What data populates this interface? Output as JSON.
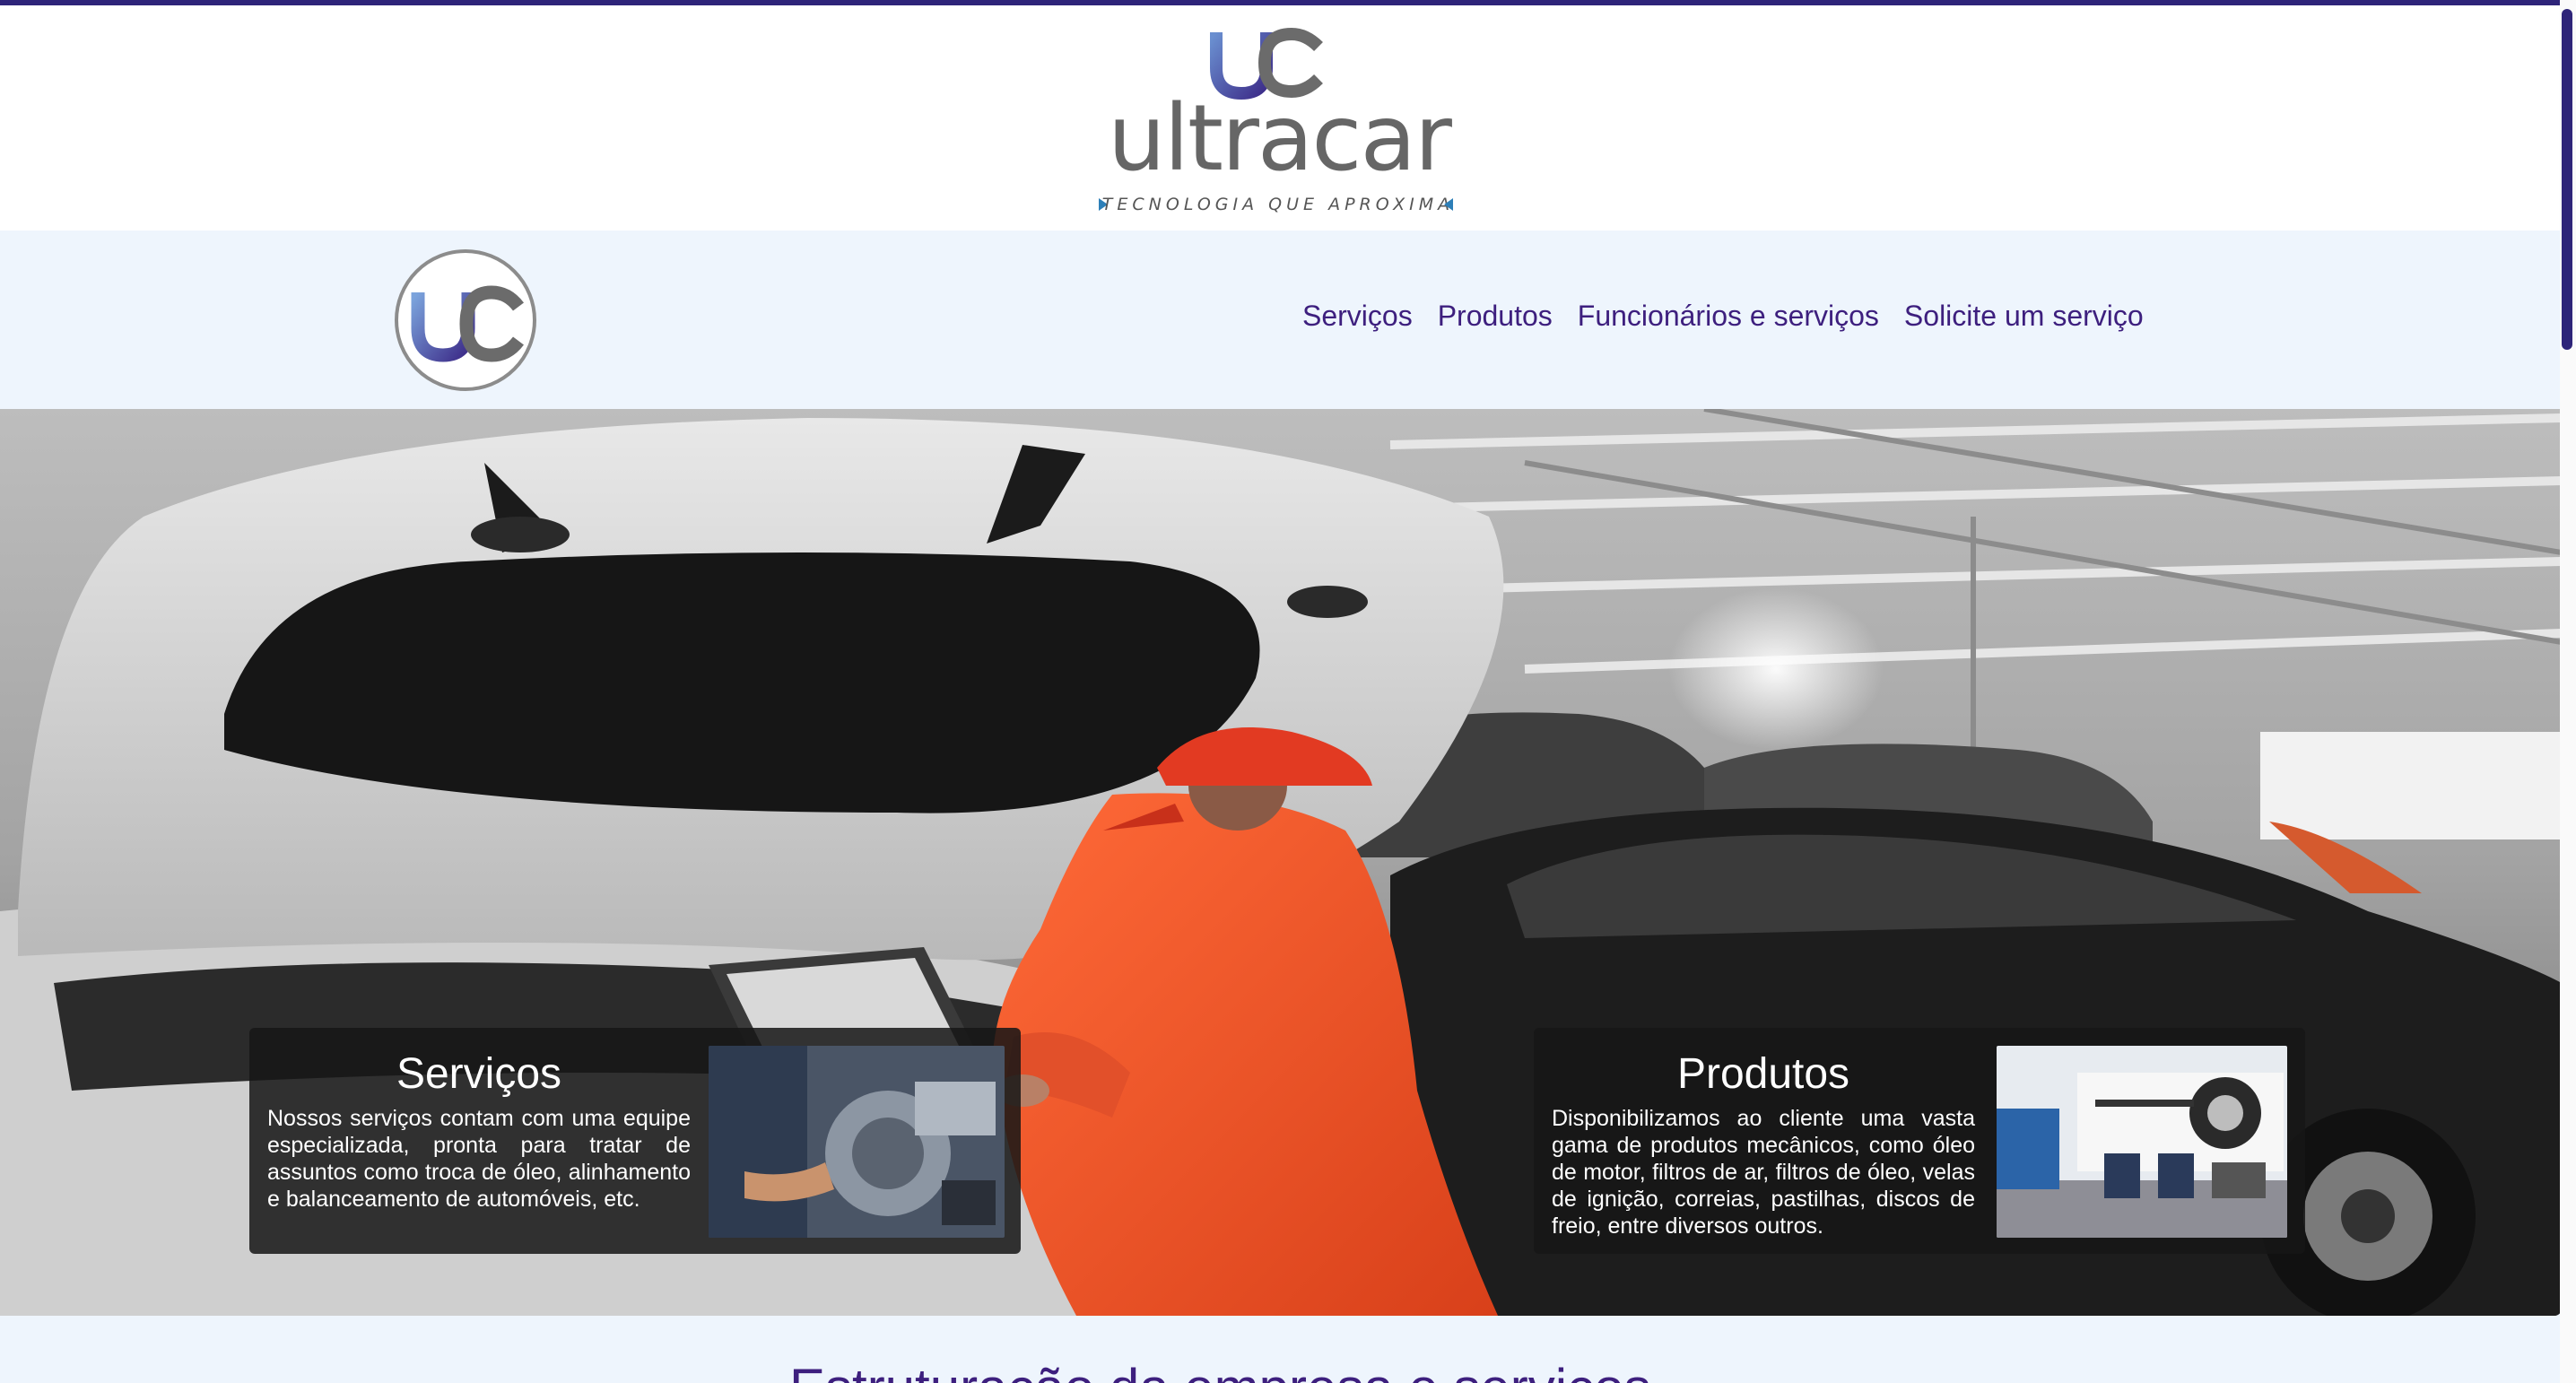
{
  "brand": {
    "wordmark": "ultracar",
    "tagline": "TECNOLOGIA QUE APROXIMA",
    "monogram": "uc"
  },
  "nav": {
    "logo_icon": "uc-logo-icon",
    "links": [
      {
        "label": "Serviços"
      },
      {
        "label": "Produtos"
      },
      {
        "label": "Funcionários e serviços"
      },
      {
        "label": "Solicite um serviço"
      }
    ]
  },
  "hero": {
    "image": "mechanic-working-under-hood-photo",
    "cards": [
      {
        "title": "Serviços",
        "text": "Nossos serviços contam com uma equipe especializada, pronta para tratar de assuntos como troca de óleo, alinhamento e balanceamento de automóveis, etc.",
        "image": "engine-repair-photo"
      },
      {
        "title": "Produtos",
        "text": "Disponibilizamos ao cliente uma vasta gama de produtos mecânicos, como óleo de motor, filtros de ar, filtros de óleo, velas de ignição, correias, pastilhas, discos de freio, entre diversos outros.",
        "image": "tire-shop-photo"
      }
    ]
  },
  "section": {
    "heading_partial": "Estruturação da empresa e serviços"
  },
  "colors": {
    "accent": "#3d1f7e",
    "top_line": "#2e2479",
    "nav_background": "#eef5fd",
    "card_background": "#161616"
  }
}
